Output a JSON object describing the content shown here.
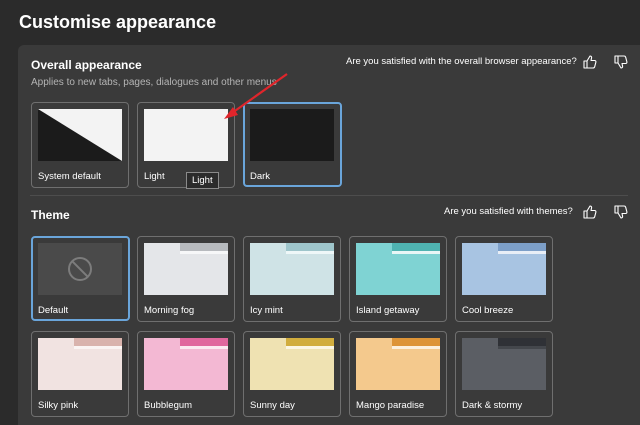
{
  "page": {
    "title": "Customise appearance"
  },
  "overall": {
    "heading": "Overall appearance",
    "subtitle": "Applies to new tabs, pages, dialogues and other menus",
    "question": "Are you satisfied with the overall browser appearance?",
    "options": [
      {
        "label": "System default",
        "selected": false
      },
      {
        "label": "Light",
        "selected": false
      },
      {
        "label": "Dark",
        "selected": true
      }
    ],
    "tooltip": "Light"
  },
  "theme": {
    "heading": "Theme",
    "question": "Are you satisfied with themes?",
    "items": [
      {
        "label": "Default",
        "selected": true,
        "icon": "blocked-circle-icon"
      },
      {
        "label": "Morning fog",
        "tab": "#b7babe",
        "body": "#e4e6e9",
        "bg": "#f6f7f8"
      },
      {
        "label": "Icy mint",
        "tab": "#9ec5cb",
        "body": "#cfe3e6",
        "bg": "#eef7f8"
      },
      {
        "label": "Island getaway",
        "tab": "#4fb3b1",
        "body": "#7fd3d3",
        "bg": "#e8f6f6"
      },
      {
        "label": "Cool breeze",
        "tab": "#7d9fc8",
        "body": "#a8c4e2",
        "bg": "#e8eef6"
      },
      {
        "label": "Silky pink",
        "tab": "#d9b3ad",
        "body": "#f1e3e1",
        "bg": "#faf4f3"
      },
      {
        "label": "Bubblegum",
        "tab": "#e0679e",
        "body": "#f3b8d3",
        "bg": "#fbe9f1"
      },
      {
        "label": "Sunny day",
        "tab": "#d1ad3e",
        "body": "#efe2b2",
        "bg": "#fbf6e4"
      },
      {
        "label": "Mango paradise",
        "tab": "#dd9438",
        "body": "#f4c98d",
        "bg": "#fcf0de"
      },
      {
        "label": "Dark & stormy",
        "tab": "#2f3136",
        "body": "#5b5e64",
        "bg": "#44474c"
      }
    ]
  },
  "colors": {
    "accent": "#6aa5da",
    "background": "#2b2b2b",
    "panel": "#3a3a3a",
    "annotation_arrow": "#e0252b"
  }
}
